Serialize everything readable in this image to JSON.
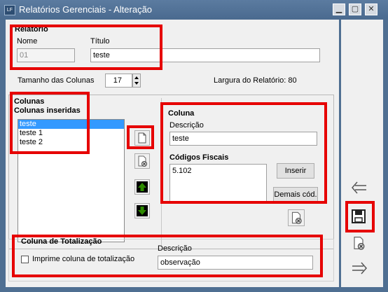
{
  "window": {
    "title": "Relatórios Gerenciais - Alteração",
    "app_icon": "LF"
  },
  "relatorio": {
    "section": "Relatorio",
    "nome_label": "Nome",
    "nome_value": "01",
    "titulo_label": "Título",
    "titulo_value": "teste"
  },
  "tamanho": {
    "label": "Tamanho das Colunas",
    "value": "17"
  },
  "largura": {
    "label": "Largura do Relatório: 80"
  },
  "colunas": {
    "section": "Colunas",
    "inseridas_label": "Colunas inseridas",
    "items": [
      "teste",
      "teste 1",
      "teste 2"
    ],
    "selected_index": 0
  },
  "coluna": {
    "section": "Coluna",
    "descricao_label": "Descrição",
    "descricao_value": "teste",
    "codigos_label": "Códigos Fiscais",
    "codigos_value": "5.102",
    "inserir_label": "Inserir",
    "demais_label": "Demais cód."
  },
  "totalizacao": {
    "section": "Coluna de Totalização",
    "checkbox_label": "Imprime coluna de totalização",
    "checked": false,
    "descricao_label": "Descrição",
    "descricao_value": "observação"
  },
  "icons": {
    "new": "new-document-icon",
    "delete": "delete-document-icon",
    "up": "arrow-up-icon",
    "down": "arrow-down-icon",
    "back": "arrow-left-icon",
    "save": "save-disk-icon",
    "forward": "arrow-right-icon"
  },
  "colors": {
    "highlight": "#e60000",
    "selection": "#3399ff",
    "move_arrow": "#2e8b00"
  }
}
